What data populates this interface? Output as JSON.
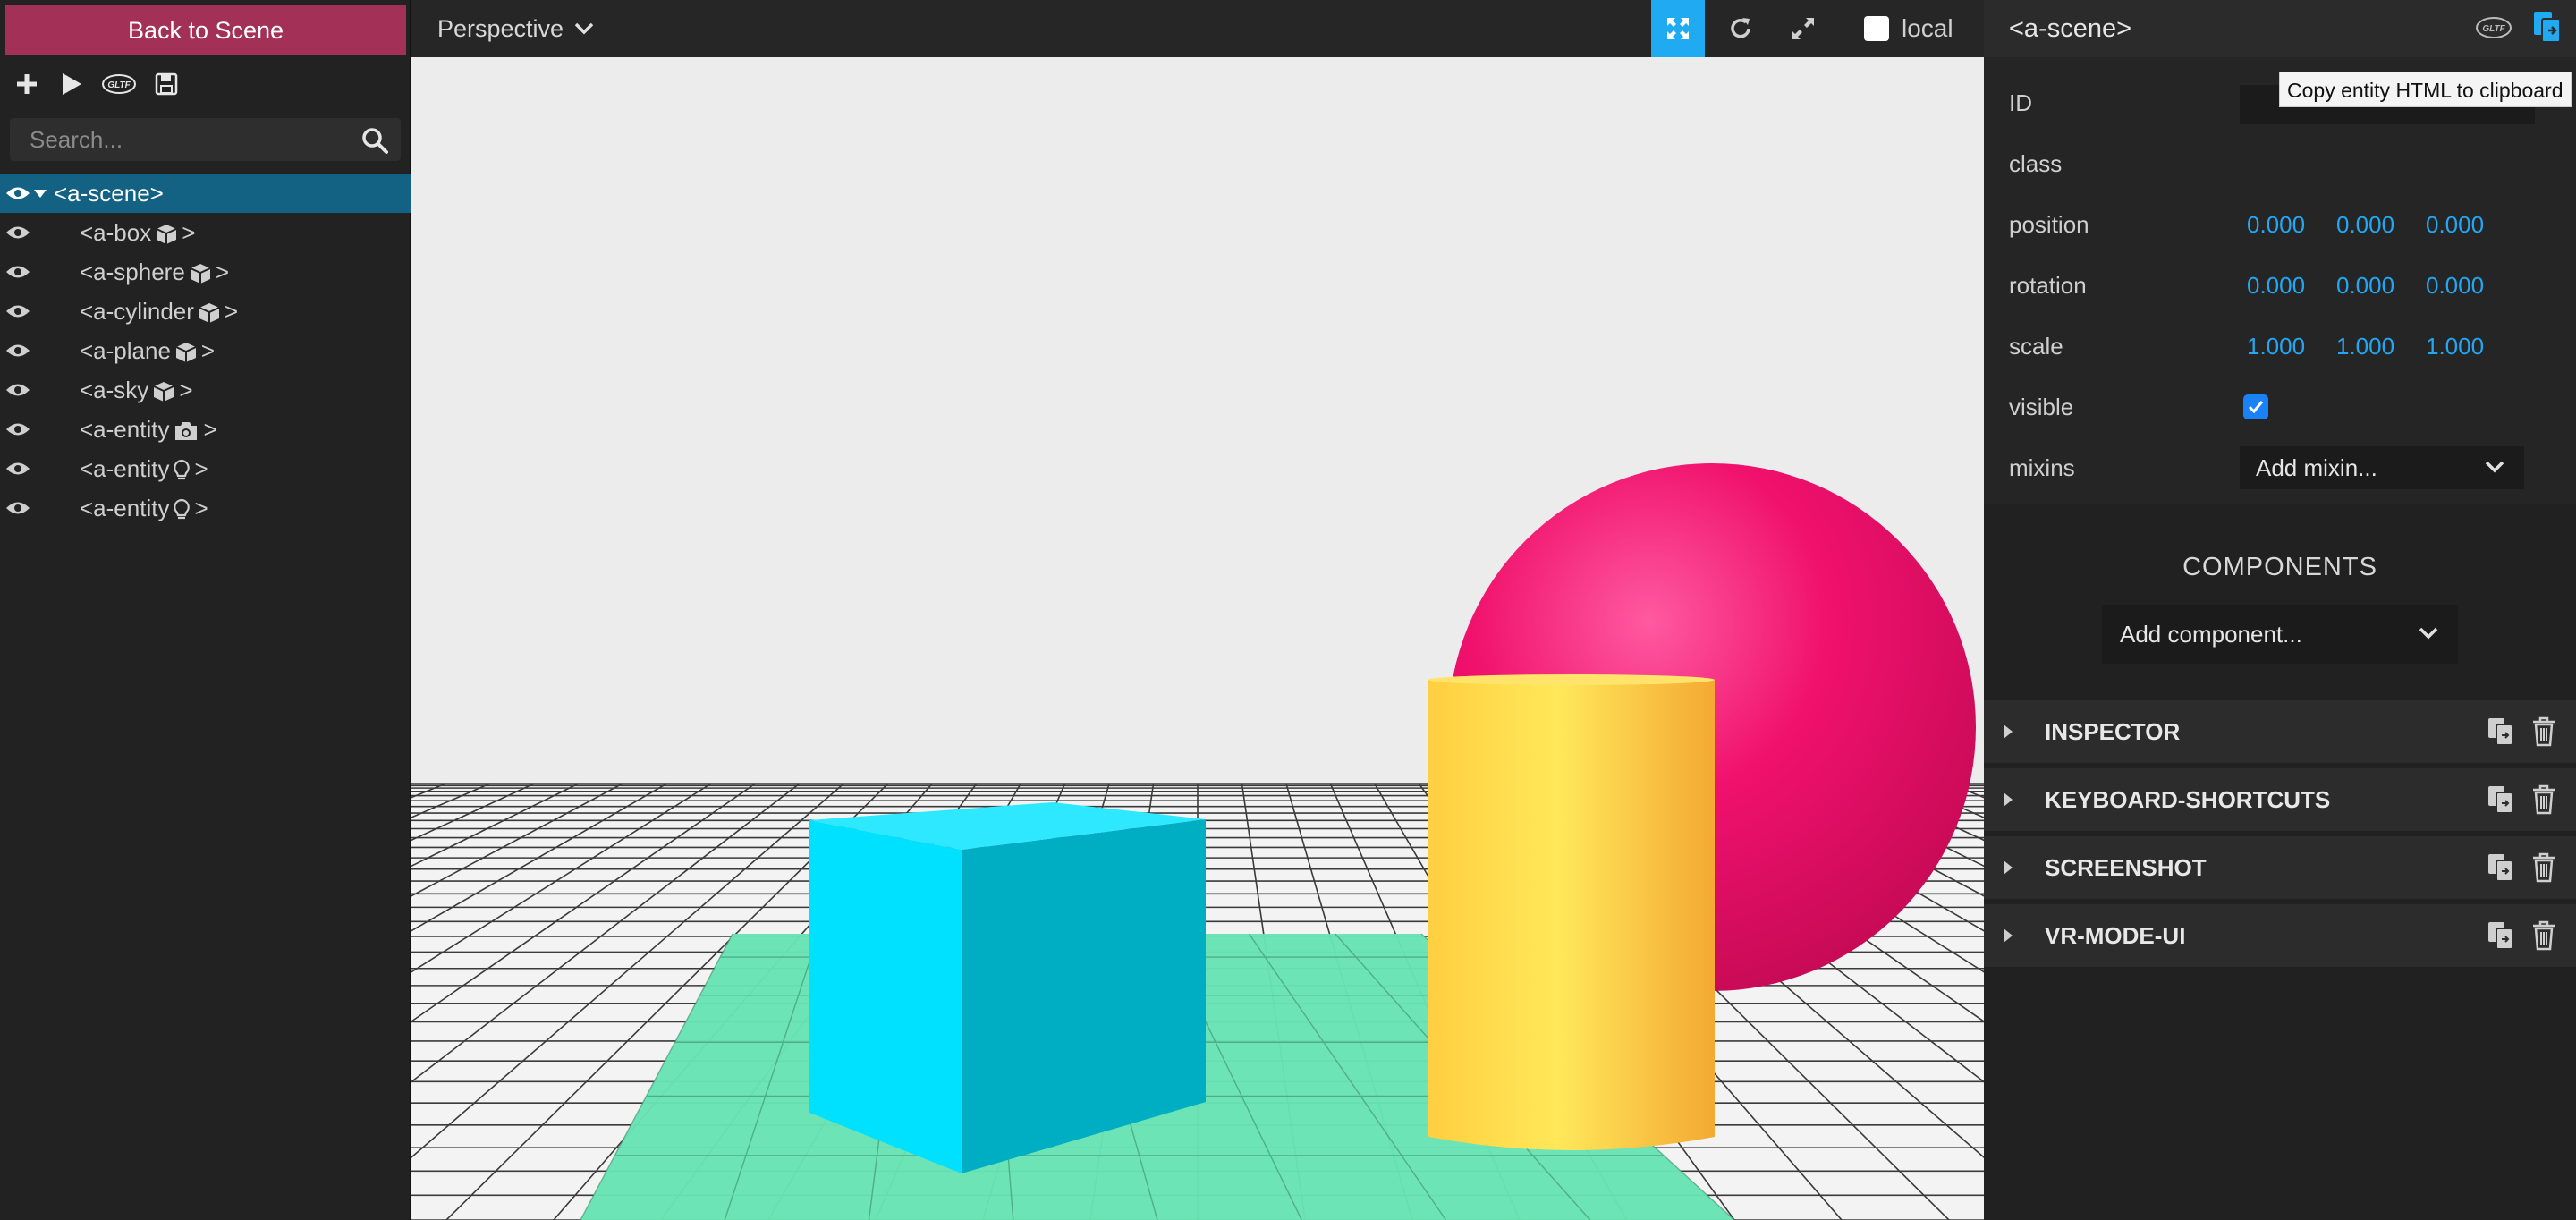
{
  "left_panel": {
    "back_button": "Back to Scene",
    "toolbar": {
      "icons": [
        "plus-icon",
        "play-icon",
        "gltf-icon",
        "save-icon"
      ],
      "gltf_badge": "GLTF"
    },
    "search": {
      "placeholder": "Search..."
    },
    "tree": [
      {
        "label": "<a-scene>",
        "selected": true
      },
      {
        "label": "<a-box",
        "suffix": ">",
        "icon": "cube-icon"
      },
      {
        "label": "<a-sphere",
        "suffix": ">",
        "icon": "cube-icon"
      },
      {
        "label": "<a-cylinder",
        "suffix": ">",
        "icon": "cube-icon"
      },
      {
        "label": "<a-plane",
        "suffix": ">",
        "icon": "cube-icon"
      },
      {
        "label": "<a-sky",
        "suffix": ">",
        "icon": "cube-icon"
      },
      {
        "label": "<a-entity",
        "suffix": ">",
        "icon": "camera-icon"
      },
      {
        "label": "<a-entity",
        "suffix": ">",
        "icon": "lightbulb-icon"
      },
      {
        "label": "<a-entity",
        "suffix": ">",
        "icon": "lightbulb-icon"
      }
    ]
  },
  "topbar": {
    "camera_mode": "Perspective",
    "local_label": "local",
    "active_tool": "translate",
    "accent": "#1faaf2"
  },
  "right_panel": {
    "entity_title": "<a-scene>",
    "tooltip": "Copy entity HTML to clipboard",
    "gltf_badge": "GLTF",
    "props": {
      "id_label": "ID",
      "id_value": "",
      "class_label": "class",
      "position_label": "position",
      "position": [
        "0.000",
        "0.000",
        "0.000"
      ],
      "rotation_label": "rotation",
      "rotation": [
        "0.000",
        "0.000",
        "0.000"
      ],
      "scale_label": "scale",
      "scale": [
        "1.000",
        "1.000",
        "1.000"
      ],
      "visible_label": "visible",
      "visible": true,
      "mixins_label": "mixins",
      "mixins_placeholder": "Add mixin..."
    },
    "components_title": "COMPONENTS",
    "add_component": "Add component...",
    "components": [
      "INSPECTOR",
      "KEYBOARD-SHORTCUTS",
      "SCREENSHOT",
      "VR-MODE-UI"
    ]
  },
  "scene": {
    "sky_color": "#ececec",
    "plane_color": "#67e3b3",
    "box_color": "#00e1ff",
    "sphere_color": "#f0116d",
    "cylinder_color": "#ffd84a"
  }
}
